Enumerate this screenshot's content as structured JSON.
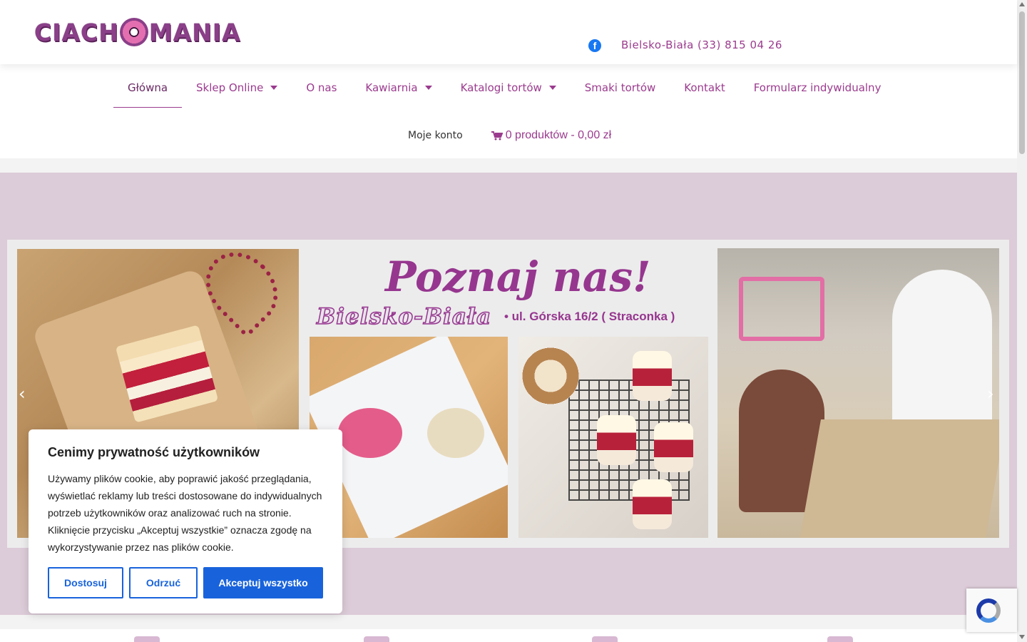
{
  "header": {
    "logo_text_left": "CIACH",
    "logo_text_right": "MANIA",
    "facebook_icon": "facebook-icon",
    "phone": "Bielsko-Biała (33) 815 04 26"
  },
  "nav": {
    "items": [
      {
        "label": "Główna",
        "active": true,
        "dropdown": false
      },
      {
        "label": "Sklep Online",
        "active": false,
        "dropdown": true
      },
      {
        "label": "O nas",
        "active": false,
        "dropdown": false
      },
      {
        "label": "Kawiarnia",
        "active": false,
        "dropdown": true
      },
      {
        "label": "Katalogi tortów",
        "active": false,
        "dropdown": true
      },
      {
        "label": "Smaki tortów",
        "active": false,
        "dropdown": false
      },
      {
        "label": "Kontakt",
        "active": false,
        "dropdown": false
      },
      {
        "label": "Formularz indywidualny",
        "active": false,
        "dropdown": false
      }
    ],
    "account": "Moje konto",
    "cart": "0 produktów - 0,00 zł"
  },
  "hero": {
    "title": "Poznaj nas!",
    "city": "Bielsko-Biała",
    "address": "• ul. Górska 16/2  ( Straconka )"
  },
  "cookie": {
    "title": "Cenimy prywatność użytkowników",
    "text": "Używamy plików cookie, aby poprawić jakość przeglądania, wyświetlać reklamy lub treści dostosowane do indywidualnych potrzeb użytkowników oraz analizować ruch na stronie. Kliknięcie przycisku „Akceptuj wszystkie” oznacza zgodę na wykorzystywanie przez nas plików cookie.",
    "btn_customize": "Dostosuj",
    "btn_reject": "Odrzuć",
    "btn_accept": "Akceptuj wszystko"
  },
  "colors": {
    "brand": "#9b3b8e",
    "hero_bg": "#dccbd8",
    "cookie_blue": "#1863dc"
  }
}
